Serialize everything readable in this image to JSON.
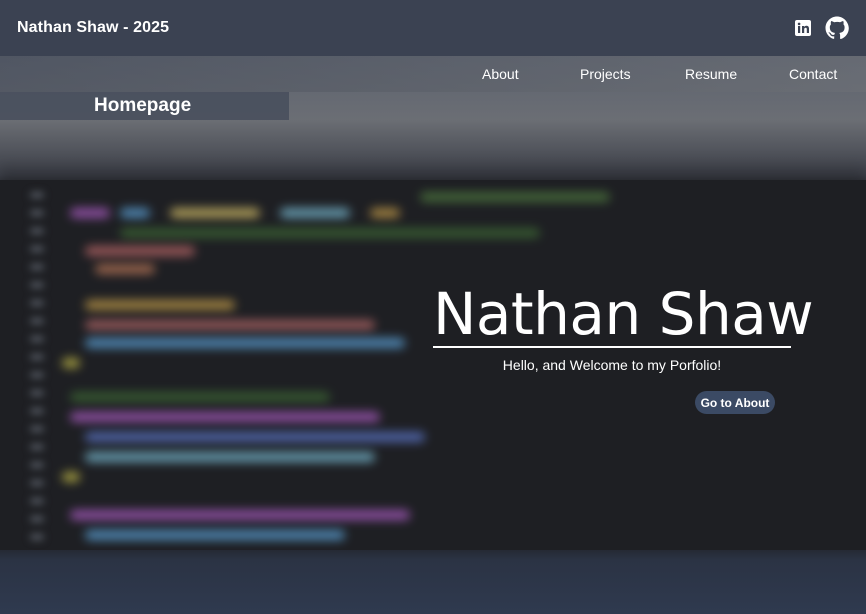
{
  "header": {
    "brand": "Nathan Shaw - 2025",
    "social_icons": [
      "linkedin-icon",
      "github-icon"
    ]
  },
  "nav": {
    "items": [
      "About",
      "Projects",
      "Resume",
      "Contact"
    ]
  },
  "page_tag": "Homepage",
  "hero": {
    "name": "Nathan Shaw",
    "subtitle": "Hello, and Welcome to my Porfolio!",
    "button_label": "Go to About"
  },
  "colors": {
    "topbar": "#3b4252",
    "button": "#3b4a64",
    "text": "#ffffff"
  }
}
